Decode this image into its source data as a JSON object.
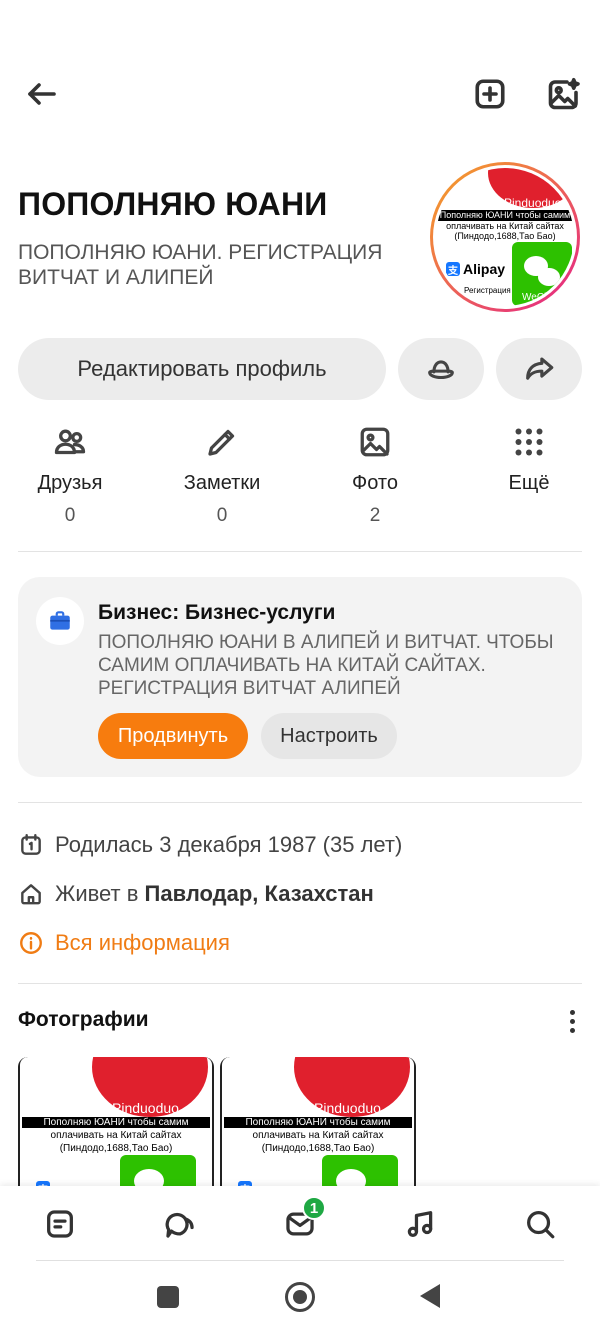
{
  "profile": {
    "name": "ПОПОЛНЯЮ ЮАНИ",
    "status": "ПОПОЛНЯЮ ЮАНИ. РЕГИСТРАЦИЯ ВИТЧАТ И АЛИПЕЙ",
    "edit_label": "Редактировать профиль"
  },
  "promo_image": {
    "brand": "Pinduoduo",
    "line1": "Пополняю ЮАНИ чтобы самим",
    "line2": "оплачивать на Китай сайтах",
    "line3": "(Пиндодо,1688,Тао Бао)",
    "alipay": "Alipay",
    "registration": "Регистрация",
    "wechat": "WeChat"
  },
  "stats": [
    {
      "label": "Друзья",
      "count": "0",
      "icon": "friends-icon"
    },
    {
      "label": "Заметки",
      "count": "0",
      "icon": "pencil-icon"
    },
    {
      "label": "Фото",
      "count": "2",
      "icon": "photo-icon"
    },
    {
      "label": "Ещё",
      "count": "",
      "icon": "grid-dots-icon"
    }
  ],
  "business": {
    "title": "Бизнес: Бизнес-услуги",
    "description": "ПОПОЛНЯЮ ЮАНИ В АЛИПЕЙ И ВИТЧАТ. ЧТОБЫ САМИМ ОПЛАЧИВАТЬ НА КИТАЙ САЙТАХ. РЕГИСТРАЦИЯ ВИТЧАТ АЛИПЕЙ",
    "promote_label": "Продвинуть",
    "setup_label": "Настроить"
  },
  "info": {
    "birth": "Родилась 3 декабря 1987 (35 лет)",
    "lives_prefix": "Живет в ",
    "lives_place": "Павлодар, Казахстан",
    "all_info": "Вся информация"
  },
  "photos": {
    "title": "Фотографии"
  },
  "bottom_nav": {
    "messages_badge": "1"
  },
  "colors": {
    "accent": "#f77c0e",
    "badge": "#1ea843",
    "avatar_ring_start": "#f5a623",
    "avatar_ring_end": "#e4208a"
  }
}
